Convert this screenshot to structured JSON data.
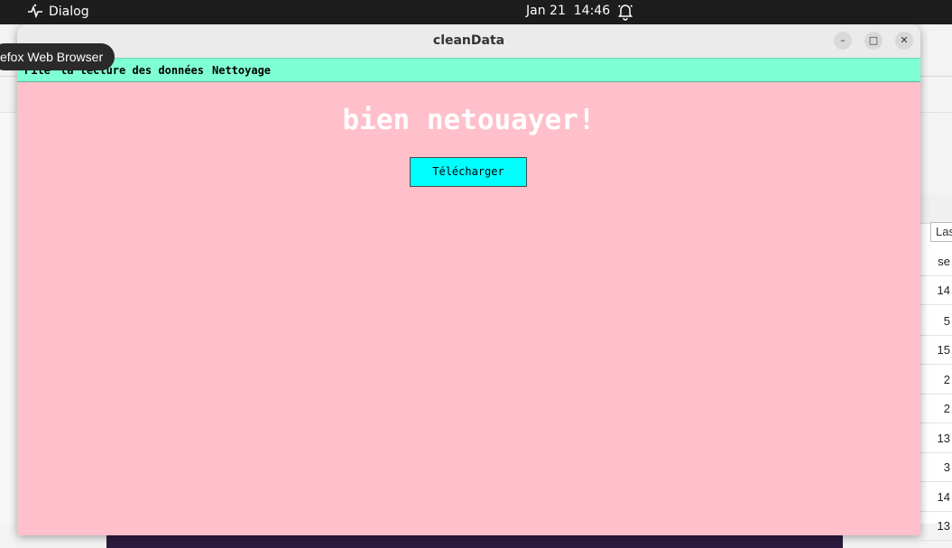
{
  "system_bar": {
    "app_name": "Dialog",
    "date": "Jan 21",
    "time": "14:46"
  },
  "tooltip": {
    "text": "efox Web Browser"
  },
  "background_browser": {
    "search_text": "Las",
    "column_cells": [
      "se",
      "14",
      "5",
      "15",
      "2",
      "2",
      "13",
      "3",
      "14",
      "13"
    ]
  },
  "window": {
    "title": "cleanData",
    "menu": [
      "File",
      "la lecture des données",
      "Nettoyage"
    ],
    "heading": "bien netouayer!",
    "download_button": "Télécharger",
    "colors": {
      "body_bg": "#ffc0cb",
      "menubar_bg": "#7fffd4",
      "button_bg": "#00ffff"
    }
  }
}
